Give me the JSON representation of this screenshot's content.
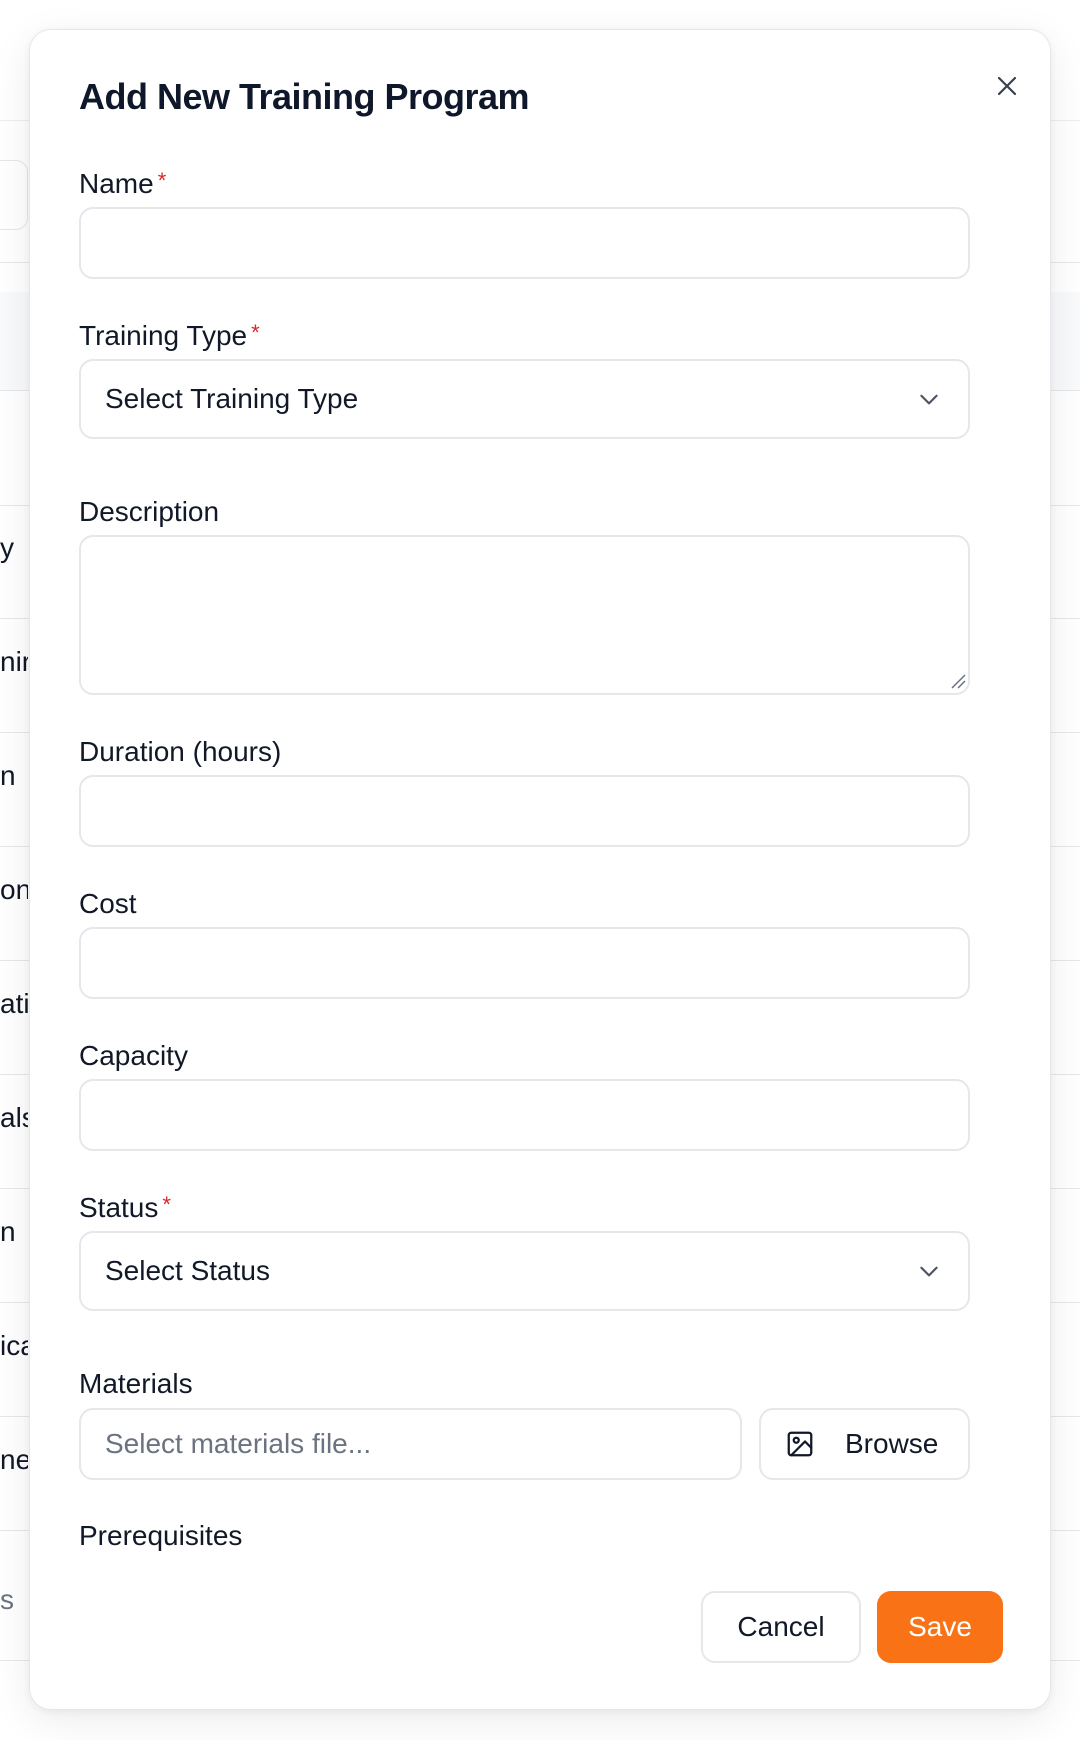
{
  "modal": {
    "title": "Add New Training Program",
    "close_icon": "close-icon"
  },
  "form": {
    "name": {
      "label": "Name",
      "required_mark": "*",
      "value": ""
    },
    "training_type": {
      "label": "Training Type",
      "required_mark": "*",
      "selected": "Select Training Type",
      "icon": "chevron-down-icon"
    },
    "description": {
      "label": "Description",
      "value": ""
    },
    "duration": {
      "label": "Duration (hours)",
      "value": ""
    },
    "cost": {
      "label": "Cost",
      "value": ""
    },
    "capacity": {
      "label": "Capacity",
      "value": ""
    },
    "status": {
      "label": "Status",
      "required_mark": "*",
      "selected": "Select Status",
      "icon": "chevron-down-icon"
    },
    "materials": {
      "label": "Materials",
      "placeholder": "Select materials file...",
      "browse_label": "Browse",
      "browse_icon": "image-icon"
    },
    "prerequisites": {
      "label": "Prerequisites"
    }
  },
  "footer": {
    "cancel_label": "Cancel",
    "save_label": "Save"
  },
  "background": {
    "row_fragments": [
      "y",
      "nir",
      "n",
      "on",
      "ati",
      "als",
      "n",
      "ica",
      "nei",
      "s"
    ]
  },
  "colors": {
    "accent": "#f97316",
    "required": "#dc2626",
    "border": "#e5e7eb",
    "text": "#111827",
    "placeholder": "#6b7280"
  }
}
